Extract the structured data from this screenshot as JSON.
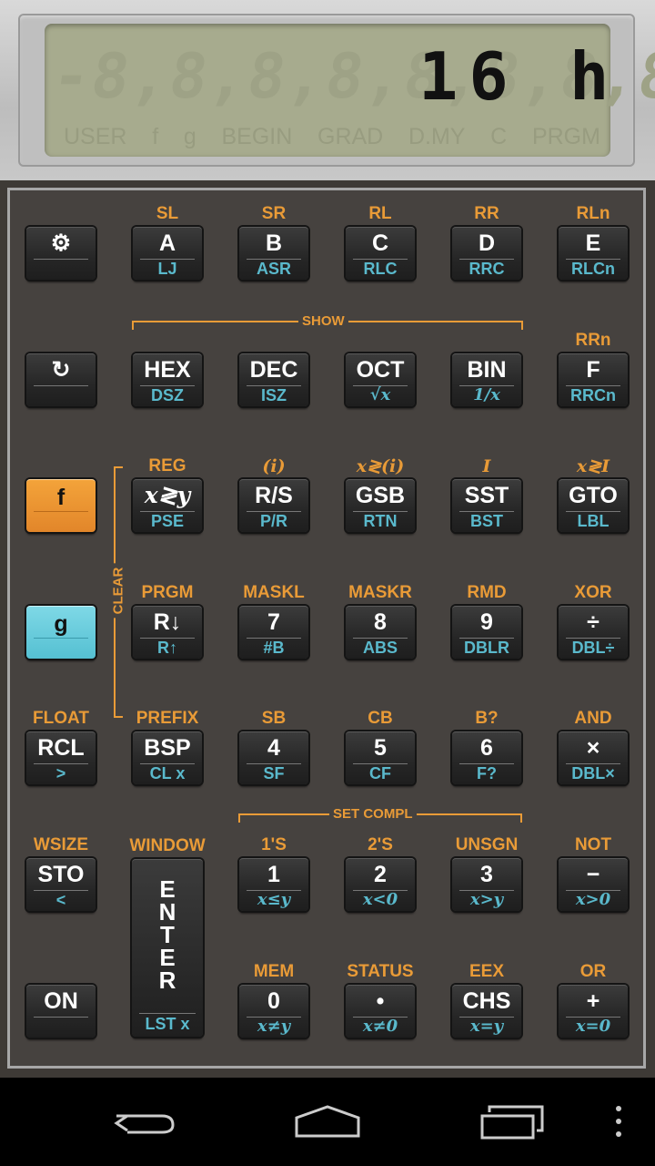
{
  "display": {
    "ghost": "-8,8,8,8,8,8,8,8,8,",
    "value": "16 h",
    "annunciators": [
      "USER",
      "f",
      "g",
      "BEGIN",
      "GRAD",
      "D.MY",
      "C",
      "PRGM"
    ]
  },
  "brackets": {
    "show": "SHOW",
    "clear": "CLEAR",
    "set_compl": "SET COMPL"
  },
  "keys": [
    {
      "id": "settings",
      "f": "⚙",
      "g": "",
      "above": ""
    },
    {
      "id": "a",
      "f": "A",
      "g": "LJ",
      "above": "SL"
    },
    {
      "id": "b",
      "f": "B",
      "g": "ASR",
      "above": "SR"
    },
    {
      "id": "c",
      "f": "C",
      "g": "RLC",
      "above": "RL"
    },
    {
      "id": "d",
      "f": "D",
      "g": "RRC",
      "above": "RR"
    },
    {
      "id": "e",
      "f": "E",
      "g": "RLCn",
      "above": "RLn"
    },
    {
      "id": "rotate",
      "f": "↻",
      "g": "",
      "above": ""
    },
    {
      "id": "hex",
      "f": "HEX",
      "g": "DSZ",
      "above": ""
    },
    {
      "id": "dec",
      "f": "DEC",
      "g": "ISZ",
      "above": ""
    },
    {
      "id": "oct",
      "f": "OCT",
      "g": "√x",
      "above": ""
    },
    {
      "id": "bin",
      "f": "BIN",
      "g": "1/x",
      "above": ""
    },
    {
      "id": "f-hex",
      "f": "F",
      "g": "RRCn",
      "above": "RRn"
    },
    {
      "id": "f-shift",
      "f": "f",
      "g": "",
      "above": ""
    },
    {
      "id": "xy",
      "f": "x≷y",
      "g": "PSE",
      "above": "REG"
    },
    {
      "id": "rs",
      "f": "R/S",
      "g": "P/R",
      "above": "(i)"
    },
    {
      "id": "gsb",
      "f": "GSB",
      "g": "RTN",
      "above": "x≷(i)"
    },
    {
      "id": "sst",
      "f": "SST",
      "g": "BST",
      "above": "I"
    },
    {
      "id": "gto",
      "f": "GTO",
      "g": "LBL",
      "above": "x≷I"
    },
    {
      "id": "g-shift",
      "f": "g",
      "g": "",
      "above": ""
    },
    {
      "id": "rdown",
      "f": "R↓",
      "g": "R↑",
      "above": "PRGM"
    },
    {
      "id": "7",
      "f": "7",
      "g": "#B",
      "above": "MASKL"
    },
    {
      "id": "8",
      "f": "8",
      "g": "ABS",
      "above": "MASKR"
    },
    {
      "id": "9",
      "f": "9",
      "g": "DBLR",
      "above": "RMD"
    },
    {
      "id": "div",
      "f": "÷",
      "g": "DBL÷",
      "above": "XOR"
    },
    {
      "id": "rcl",
      "f": "RCL",
      "g": ">",
      "above": "FLOAT"
    },
    {
      "id": "bsp",
      "f": "BSP",
      "g": "CL x",
      "above": "PREFIX"
    },
    {
      "id": "4",
      "f": "4",
      "g": "SF",
      "above": "SB"
    },
    {
      "id": "5",
      "f": "5",
      "g": "CF",
      "above": "CB"
    },
    {
      "id": "6",
      "f": "6",
      "g": "F?",
      "above": "B?"
    },
    {
      "id": "mul",
      "f": "×",
      "g": "DBL×",
      "above": "AND"
    },
    {
      "id": "sto",
      "f": "STO",
      "g": "<",
      "above": "WSIZE"
    },
    {
      "id": "1",
      "f": "1",
      "g": "x≤y",
      "above": "1'S"
    },
    {
      "id": "2",
      "f": "2",
      "g": "x<0",
      "above": "2'S"
    },
    {
      "id": "3",
      "f": "3",
      "g": "x>y",
      "above": "UNSGN"
    },
    {
      "id": "sub",
      "f": "−",
      "g": "x>0",
      "above": "NOT"
    },
    {
      "id": "on",
      "f": "ON",
      "g": "",
      "above": ""
    },
    {
      "id": "0",
      "f": "0",
      "g": "x≠y",
      "above": "MEM"
    },
    {
      "id": "dot",
      "f": "•",
      "g": "x≠0",
      "above": "STATUS"
    },
    {
      "id": "chs",
      "f": "CHS",
      "g": "x=y",
      "above": "EEX"
    },
    {
      "id": "add",
      "f": "+",
      "g": "x=0",
      "above": "OR"
    }
  ],
  "enter": {
    "f": "ENTER",
    "g": "LST x",
    "above": "WINDOW"
  },
  "nav": {
    "back": "back-icon",
    "home": "home-icon",
    "recents": "recents-icon",
    "menu": "overflow-menu-icon"
  }
}
